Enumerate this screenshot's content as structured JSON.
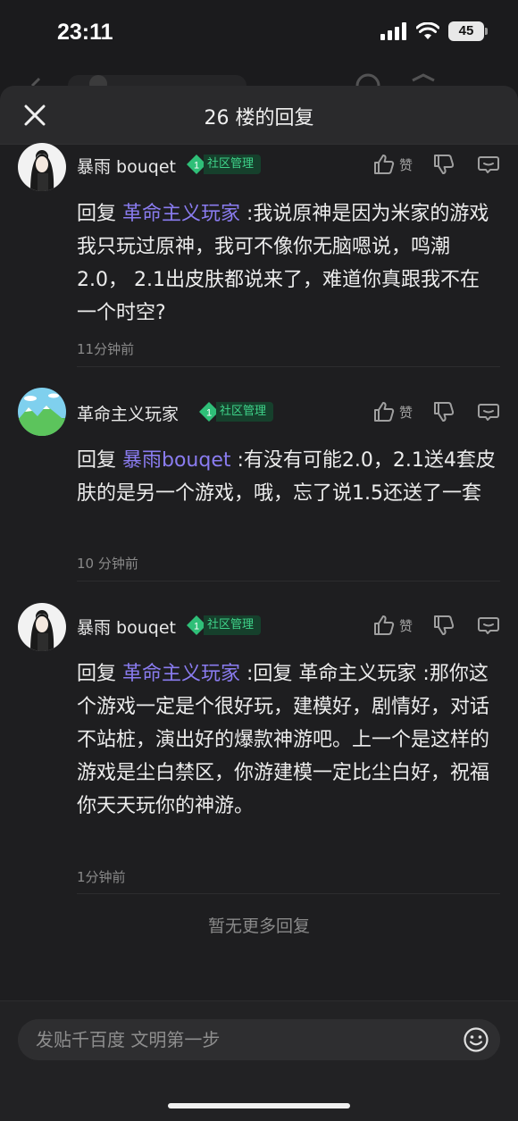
{
  "status_bar": {
    "time": "23:11",
    "battery": "45"
  },
  "sheet": {
    "title": "26 楼的回复"
  },
  "comments": [
    {
      "username": "暴雨 bouqet",
      "badge_level": "1",
      "badge_label": "社区管理",
      "like_label": "赞",
      "reply_prefix": "回复 ",
      "mention": "革命主义玩家",
      "text": " :我说原神是因为米家的游戏我只玩过原神，我可不像你无脑嗯说，鸣潮2.0， 2.1出皮肤都说来了，难道你真跟我不在一个时空?",
      "time": "11分钟前"
    },
    {
      "username": "革命主义玩家",
      "badge_level": "1",
      "badge_label": "社区管理",
      "like_label": "赞",
      "reply_prefix": "回复 ",
      "mention": "暴雨bouqet",
      "text": " :有没有可能2.0，2.1送4套皮肤的是另一个游戏，哦，忘了说1.5还送了一套",
      "time": "10 分钟前"
    },
    {
      "username": "暴雨 bouqet",
      "badge_level": "1",
      "badge_label": "社区管理",
      "like_label": "赞",
      "reply_prefix": "回复 ",
      "mention": "革命主义玩家",
      "text": " :回复 革命主义玩家 :那你这个游戏一定是个很好玩，建模好，剧情好，对话不站桩，演出好的爆款神游吧。上一个是这样的游戏是尘白禁区，你游建模一定比尘白好，祝福你天天玩你的神游。",
      "time": "1分钟前"
    }
  ],
  "footer": {
    "no_more": "暂无更多回复"
  },
  "input": {
    "placeholder": "发贴千百度 文明第一步"
  },
  "icons": {
    "close": "close-icon",
    "like": "thumbs-up-icon",
    "dislike": "thumbs-down-icon",
    "reply": "comment-icon",
    "emoji": "smiley-icon",
    "badge": "gem-icon"
  },
  "colors": {
    "mention": "#8a7cf0",
    "badge_text": "#3fd38a",
    "badge_bg": "#16402c"
  }
}
